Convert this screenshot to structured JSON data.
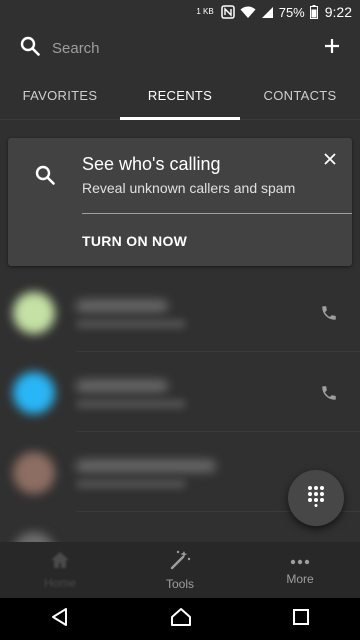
{
  "status": {
    "network_speed": "1 KB",
    "battery": "75%",
    "time": "9:22"
  },
  "search": {
    "placeholder": "Search"
  },
  "tabs": [
    {
      "label": "FAVORITES",
      "active": false
    },
    {
      "label": "RECENTS",
      "active": true
    },
    {
      "label": "CONTACTS",
      "active": false
    }
  ],
  "promo": {
    "title": "See who's calling",
    "subtitle": "Reveal unknown callers and spam",
    "action": "TURN ON NOW"
  },
  "recents": [
    {
      "avatar_color": "#c5e1a5"
    },
    {
      "avatar_color": "#29b6f6"
    },
    {
      "avatar_color": "#8d6e63"
    }
  ],
  "bottom_nav": [
    {
      "label": "Home",
      "icon": "home-icon"
    },
    {
      "label": "Tools",
      "icon": "magic-wand-icon"
    },
    {
      "label": "More",
      "icon": "more-horizontal-icon"
    }
  ],
  "colors": {
    "background": "#303030",
    "card": "#424242",
    "nav": "#282828"
  }
}
